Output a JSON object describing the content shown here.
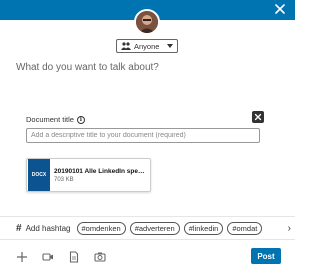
{
  "audience": {
    "label": "Anyone"
  },
  "composer": {
    "prompt": "What do you want to talk about?"
  },
  "document": {
    "title_label": "Document title",
    "title_placeholder": "Add a descriptive title to your document (required)",
    "thumb_label": "DOCX",
    "file_name": "20190101 Alle LinkedIn speci…",
    "file_size": "703 KB"
  },
  "hashtags": {
    "add_label": "Add hashtag",
    "tags": [
      "#omdenken",
      "#adverteren",
      "#linkedin",
      "#omdat"
    ]
  },
  "footer": {
    "post_label": "Post"
  },
  "colors": {
    "brand": "#0073b1",
    "docx": "#0c5391"
  }
}
